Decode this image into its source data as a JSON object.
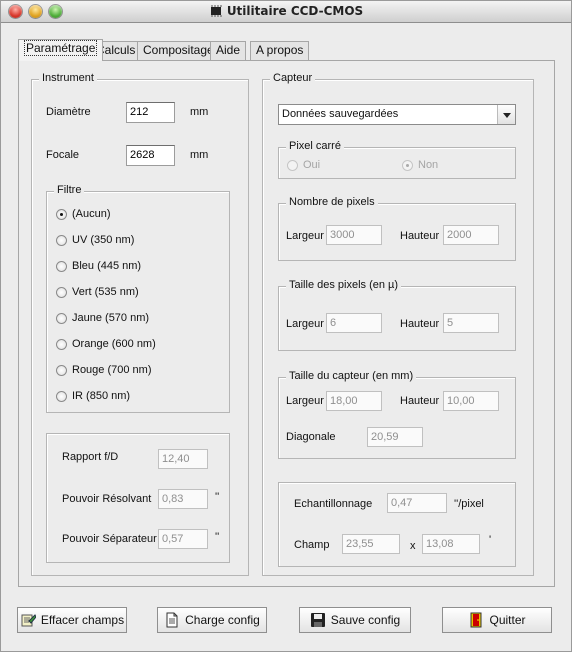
{
  "window": {
    "title": "Utilitaire CCD-CMOS"
  },
  "tabs": [
    "Paramétrage",
    "Calculs",
    "Compositage",
    "Aide",
    "A propos"
  ],
  "instrument": {
    "legend": "Instrument",
    "diametre_label": "Diamètre",
    "diametre_value": "212",
    "diametre_unit": "mm",
    "focale_label": "Focale",
    "focale_value": "2628",
    "focale_unit": "mm"
  },
  "filtre": {
    "legend": "Filtre",
    "options": [
      "(Aucun)",
      "UV (350 nm)",
      "Bleu (445 nm)",
      "Vert (535 nm)",
      "Jaune (570 nm)",
      "Orange (600 nm)",
      "Rouge (700 nm)",
      "IR (850 nm)"
    ],
    "selected": "(Aucun)"
  },
  "results": {
    "rapport_label": "Rapport f/D",
    "rapport_value": "12,40",
    "resolvant_label": "Pouvoir Résolvant",
    "resolvant_value": "0,83",
    "resolvant_unit": "''",
    "separateur_label": "Pouvoir Séparateur",
    "separateur_value": "0,57",
    "separateur_unit": "''"
  },
  "capteur": {
    "legend": "Capteur",
    "select_value": "Données sauvegardées",
    "pixel_carre": {
      "legend": "Pixel carré",
      "oui": "Oui",
      "non": "Non",
      "selected": "Non"
    },
    "nombre_pixels": {
      "legend": "Nombre de pixels",
      "largeur_label": "Largeur",
      "largeur_value": "3000",
      "hauteur_label": "Hauteur",
      "hauteur_value": "2000"
    },
    "taille_pixels": {
      "legend": "Taille des pixels (en µ)",
      "largeur_label": "Largeur",
      "largeur_value": "6",
      "hauteur_label": "Hauteur",
      "hauteur_value": "5"
    },
    "taille_capteur": {
      "legend": "Taille du capteur (en mm)",
      "largeur_label": "Largeur",
      "largeur_value": "18,00",
      "hauteur_label": "Hauteur",
      "hauteur_value": "10,00",
      "diagonale_label": "Diagonale",
      "diagonale_value": "20,59"
    },
    "echantillonnage_label": "Echantillonnage",
    "echantillonnage_value": "0,47",
    "echantillonnage_unit": "''/pixel",
    "champ_label": "Champ",
    "champ_x": "23,55",
    "champ_sep": "x",
    "champ_y": "13,08",
    "champ_unit": "'"
  },
  "buttons": {
    "effacer": "Effacer champs",
    "charge": "Charge config",
    "sauve": "Sauve config",
    "quitter": "Quitter"
  }
}
